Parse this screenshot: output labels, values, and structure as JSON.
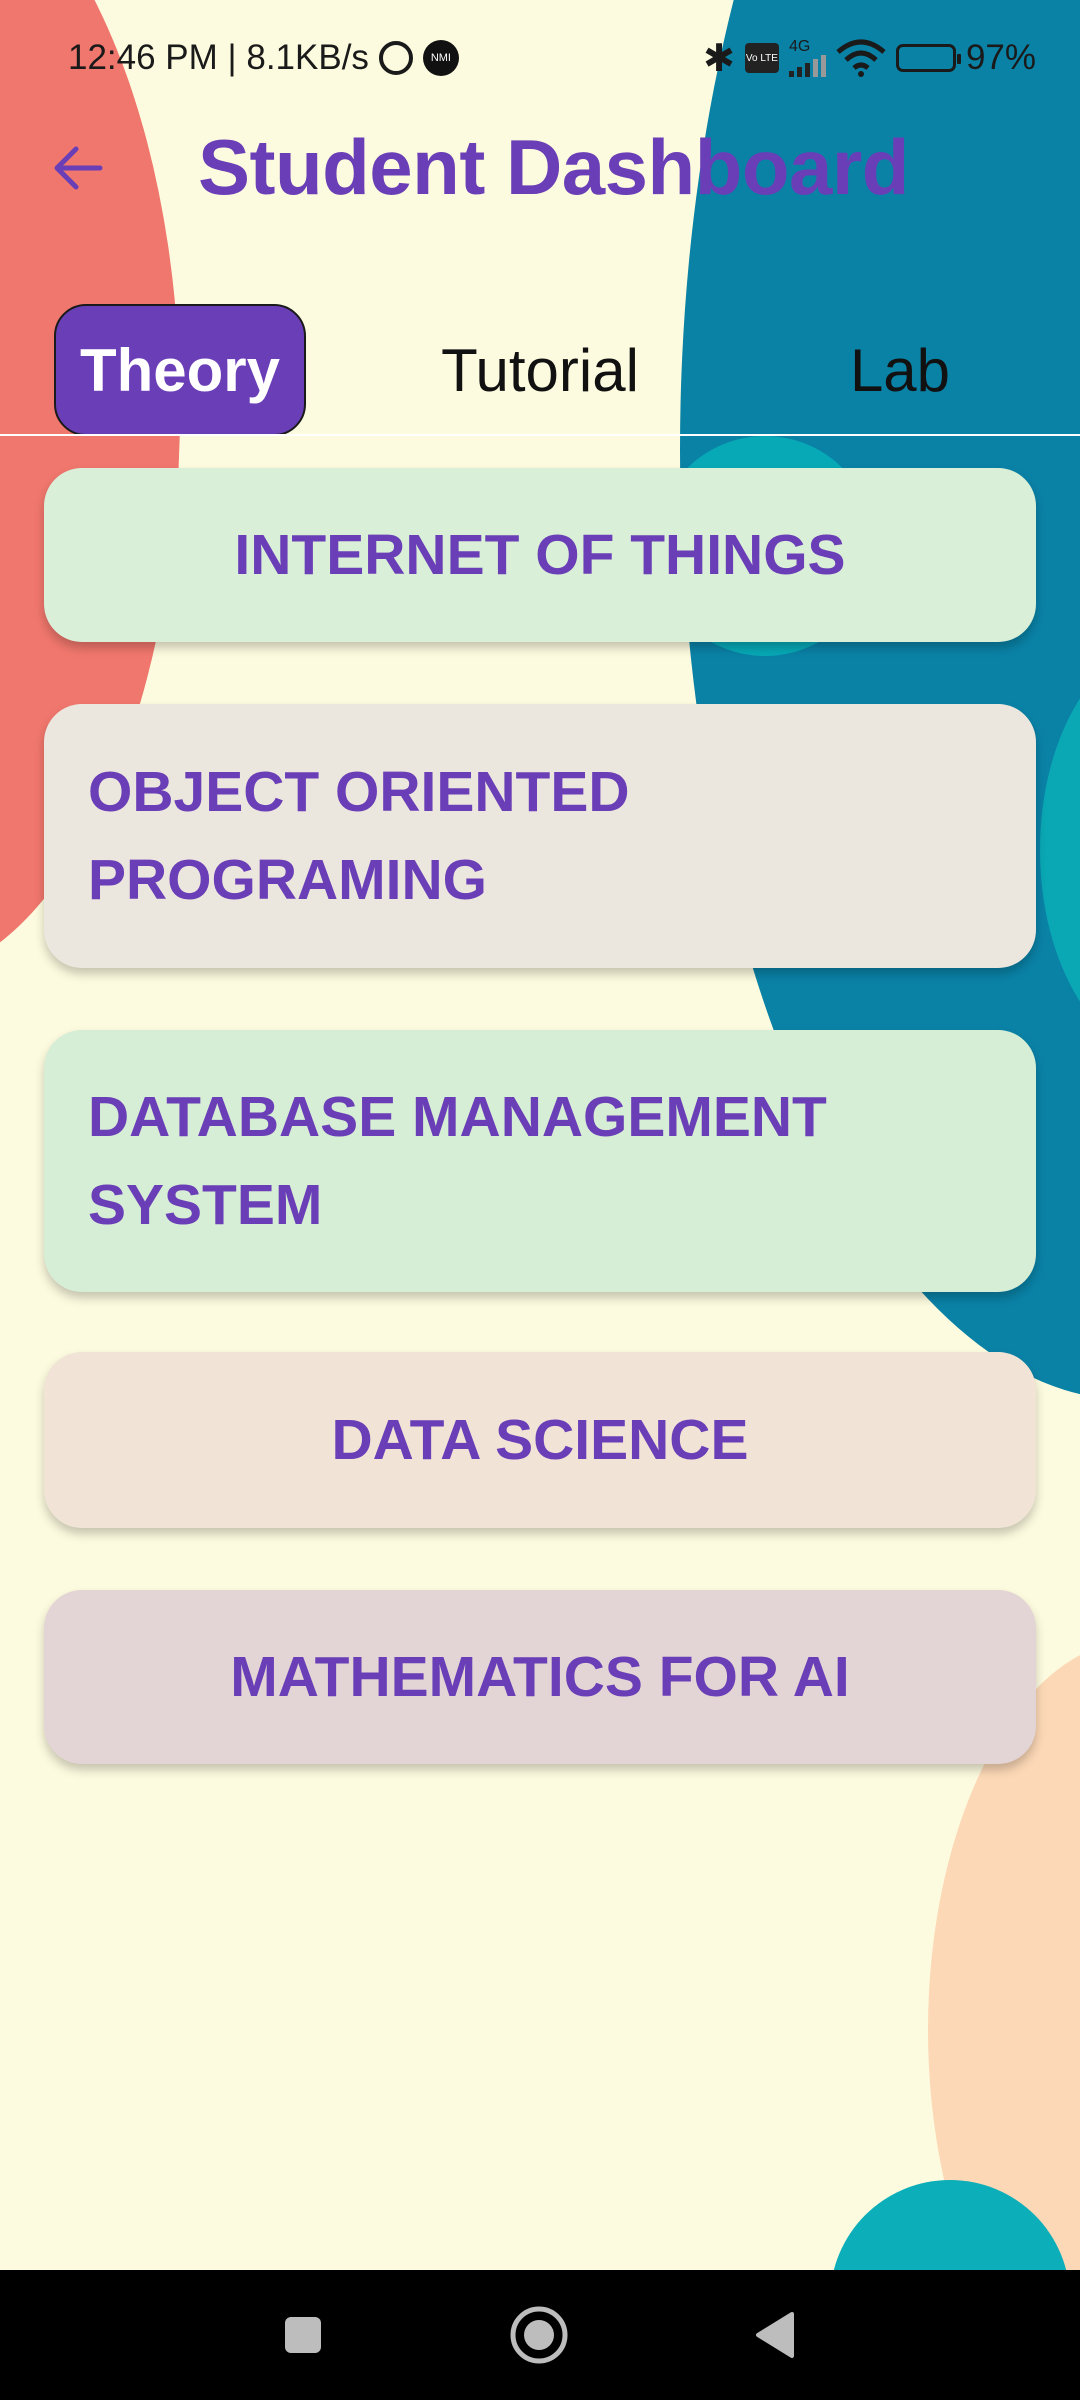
{
  "status_bar": {
    "time_speed": "12:46 PM | 8.1KB/s",
    "network": "4G",
    "volte": "Vo LTE",
    "battery": "97%",
    "icons": [
      "alarm-icon",
      "nfc-icon",
      "bluetooth-icon",
      "volte-icon",
      "signal-icon",
      "wifi-icon",
      "battery-icon"
    ]
  },
  "header": {
    "back_icon": "arrow-left-icon",
    "title": "Student Dashboard"
  },
  "tabs": [
    {
      "label": "Theory",
      "active": true
    },
    {
      "label": "Tutorial",
      "active": false
    },
    {
      "label": "Lab",
      "active": false
    }
  ],
  "subjects": [
    {
      "label": "INTERNET OF THINGS",
      "color": "#d9efd8"
    },
    {
      "label": "OBJECT ORIENTED PROGRAMING",
      "color": "#ece7de"
    },
    {
      "label": "DATABASE MANAGEMENT SYSTEM",
      "color": "#d7eed6"
    },
    {
      "label": "DATA SCIENCE",
      "color": "#f1e4d6"
    },
    {
      "label": "MATHEMATICS FOR AI",
      "color": "#e3d5d5"
    }
  ],
  "colors": {
    "accent": "#6a3eb6",
    "background": "#fdfbdf"
  },
  "nav_bar": {
    "buttons": [
      "recents-square-icon",
      "home-circle-icon",
      "back-triangle-icon"
    ]
  }
}
